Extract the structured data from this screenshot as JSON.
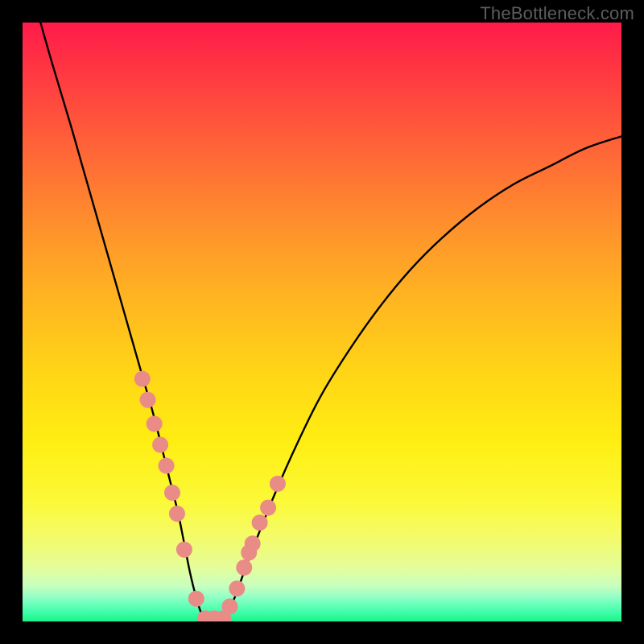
{
  "watermark": "TheBottleneck.com",
  "chart_data": {
    "type": "line",
    "title": "",
    "xlabel": "",
    "ylabel": "",
    "xlim": [
      0,
      100
    ],
    "ylim": [
      0,
      100
    ],
    "grid": false,
    "series": [
      {
        "name": "bottleneck-curve",
        "x": [
          3,
          5,
          8,
          10,
          12,
          14,
          16,
          18,
          20,
          22,
          24,
          25,
          26,
          27,
          28,
          29,
          30,
          31,
          33,
          35,
          38,
          42,
          46,
          50,
          55,
          60,
          65,
          70,
          76,
          82,
          88,
          94,
          100
        ],
        "y": [
          100,
          93,
          83,
          76,
          69,
          62,
          55,
          48,
          41,
          34,
          26,
          22,
          18,
          13,
          8,
          4,
          1,
          0,
          0,
          3,
          11,
          21,
          30,
          38,
          46,
          53,
          59,
          64,
          69,
          73,
          76,
          79,
          81
        ]
      }
    ],
    "markers": [
      {
        "name": "highlight-dots",
        "x": [
          20.0,
          20.9,
          22.0,
          23.0,
          24.0,
          25.0,
          25.8,
          27.0,
          29.0,
          30.5,
          32.0,
          33.5,
          34.6,
          35.8,
          37.0,
          37.8,
          38.4,
          39.6,
          41.0,
          42.6
        ],
        "y": [
          40.5,
          37.0,
          33.0,
          29.5,
          26.0,
          21.5,
          18.0,
          12.0,
          3.8,
          0.5,
          0.5,
          0.5,
          2.5,
          5.5,
          9.0,
          11.5,
          13.0,
          16.5,
          19.0,
          23.0
        ]
      }
    ],
    "background_gradient": {
      "top": "#ff1a4a",
      "mid": "#ffee12",
      "bottom": "#18f58a"
    }
  }
}
